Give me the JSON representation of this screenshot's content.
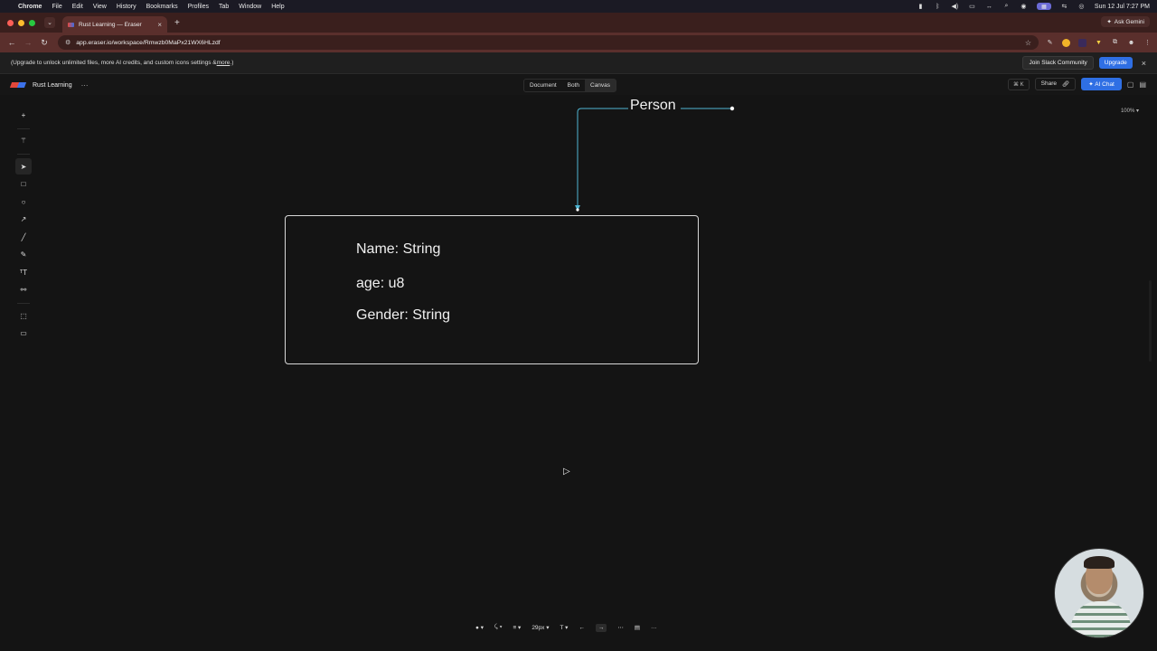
{
  "menubar": {
    "app": "Chrome",
    "items": [
      "File",
      "Edit",
      "View",
      "History",
      "Bookmarks",
      "Profiles",
      "Tab",
      "Window",
      "Help"
    ],
    "datetime": "Sun 12 Jul  7:27 PM"
  },
  "browser": {
    "tab_title": "Rust Learning — Eraser",
    "url": "app.eraser.io/workspace/Rmwzb0MaPx21WX6HLzdf",
    "ask_gemini": "Ask Gemini"
  },
  "banner": {
    "text": "(Upgrade to unlock unlimited files, more AI credits, and custom icons settings & ",
    "more": "more",
    "text_end": ".)",
    "join_slack": "Join Slack Community",
    "upgrade": "Upgrade"
  },
  "appbar": {
    "title": "Rust Learning",
    "views": [
      "Document",
      "Both",
      "Canvas"
    ],
    "active_view": "Canvas",
    "shortcut": "⌘ K",
    "share": "Share",
    "ai_chat": "AI Chat"
  },
  "canvas": {
    "zoom": "100% ▾",
    "diagram": {
      "label": "Person",
      "fields": [
        "Name: String",
        "age: u8",
        "Gender: String"
      ],
      "connector_color": "#4fb6d4"
    }
  },
  "format_bar": {
    "font_size": "29px"
  },
  "colors": {
    "accent": "#2f6fe4",
    "tab_bar": "#3a1f1d",
    "canvas_bg": "#141414"
  }
}
